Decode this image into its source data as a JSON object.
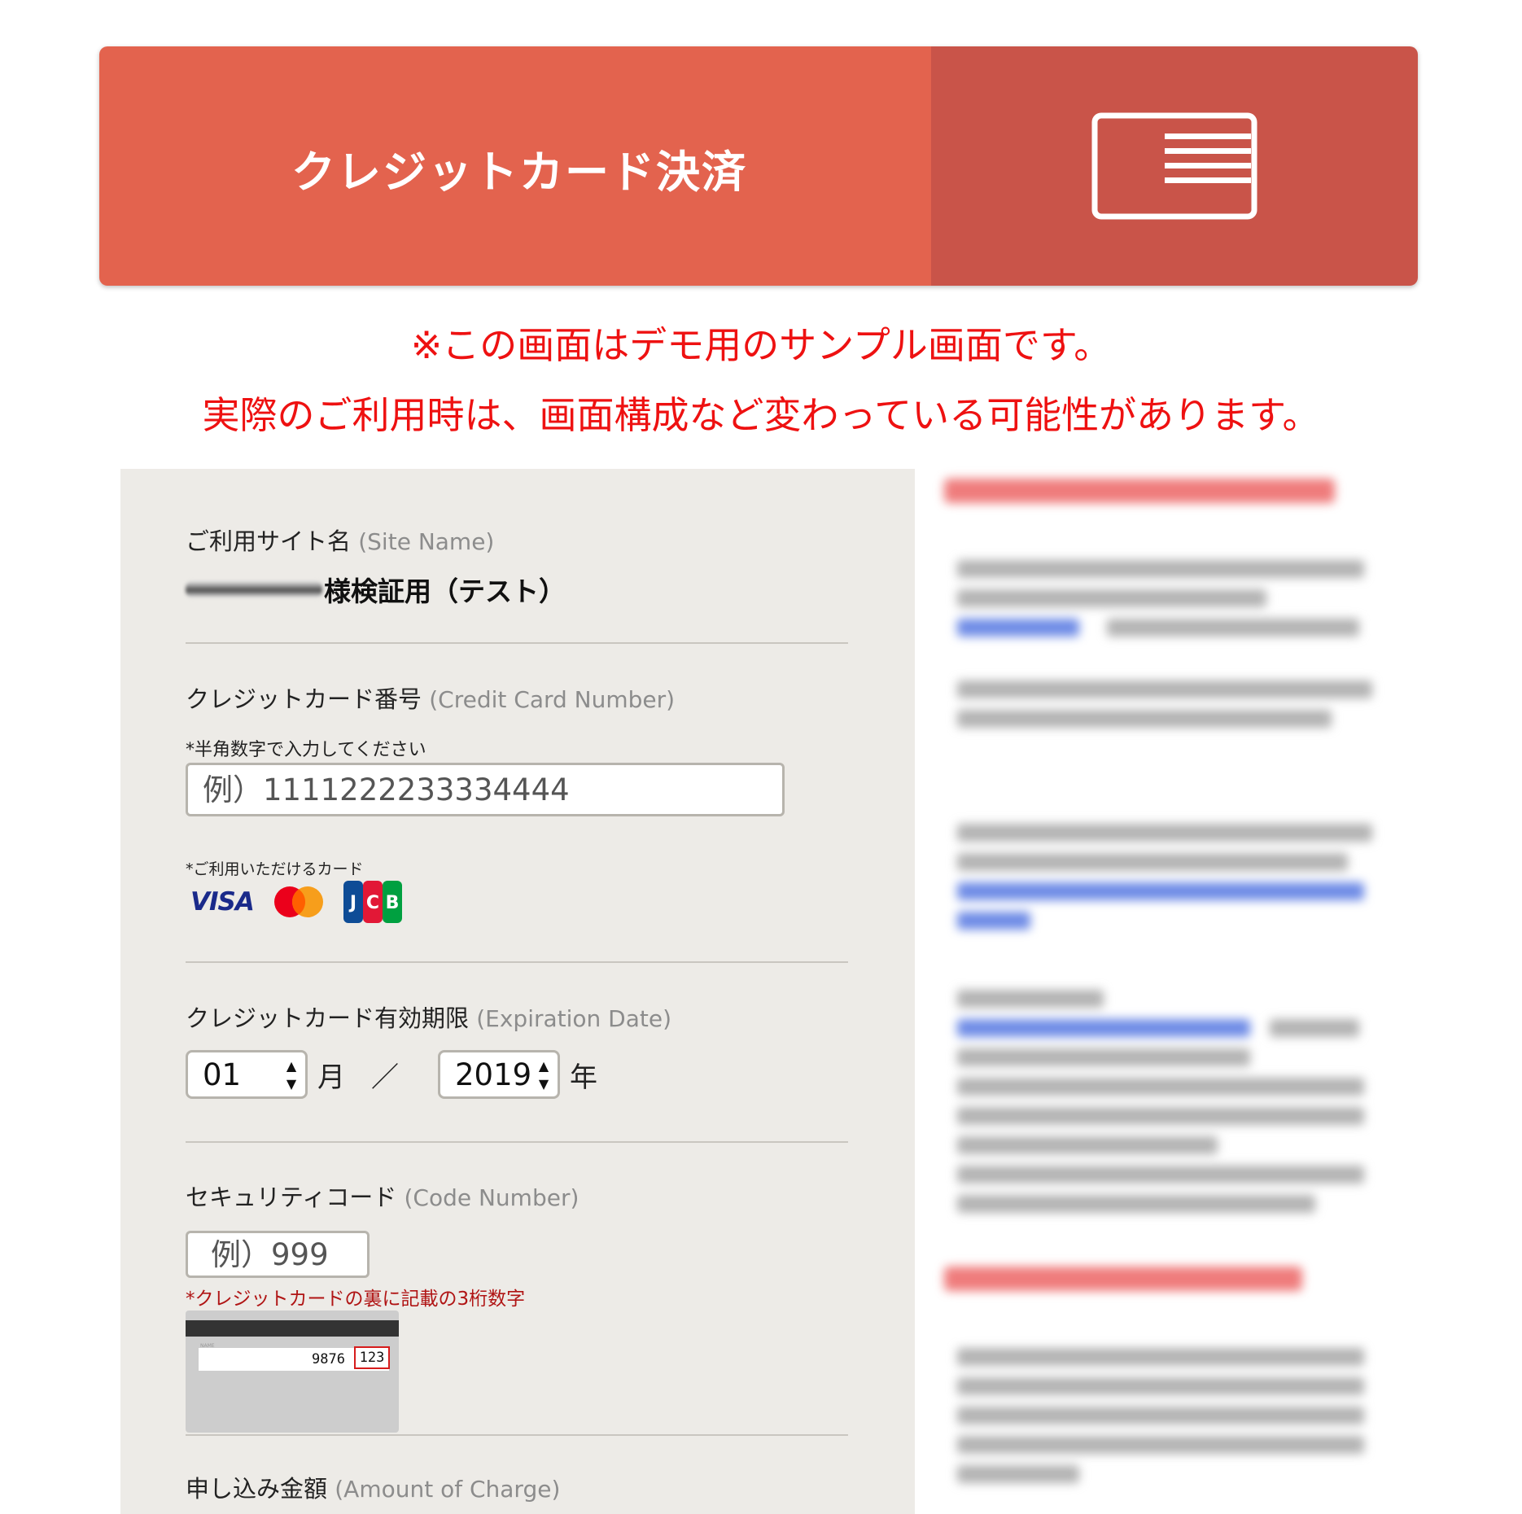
{
  "banner": {
    "title": "クレジットカード決済",
    "icon": "credit-card-icon",
    "color_left": "#e3634e",
    "color_right": "#c95449"
  },
  "notice": {
    "line1": "※この画面はデモ用のサンプル画面です。",
    "line2": "実際のご利用時は、画面構成など変わっている可能性があります。",
    "color": "#ee1111"
  },
  "form": {
    "site": {
      "label": "ご利用サイト名",
      "label_en": "(Site Name)",
      "value": "様検証用（テスト）"
    },
    "card_number": {
      "label": "クレジットカード番号",
      "label_en": "(Credit Card Number)",
      "hint": "*半角数字で入力してください",
      "placeholder": "例）1111222233334444",
      "accepted_label": "*ご利用いただけるカード",
      "brands": [
        "VISA",
        "Mastercard",
        "JCB"
      ]
    },
    "expiry": {
      "label": "クレジットカード有効期限",
      "label_en": "(Expiration Date)",
      "month_value": "01",
      "month_unit": "月",
      "separator": "／",
      "year_value": "2019",
      "year_unit": "年"
    },
    "security": {
      "label": "セキュリティコード",
      "label_en": "(Code Number)",
      "placeholder": "例）999",
      "hint": "*クレジットカードの裏に記載の3桁数字",
      "card_name": "NAME",
      "card_digits": "9876",
      "card_cvv": "123"
    },
    "amount": {
      "label": "申し込み金額",
      "label_en": "(Amount of Charge)"
    }
  }
}
